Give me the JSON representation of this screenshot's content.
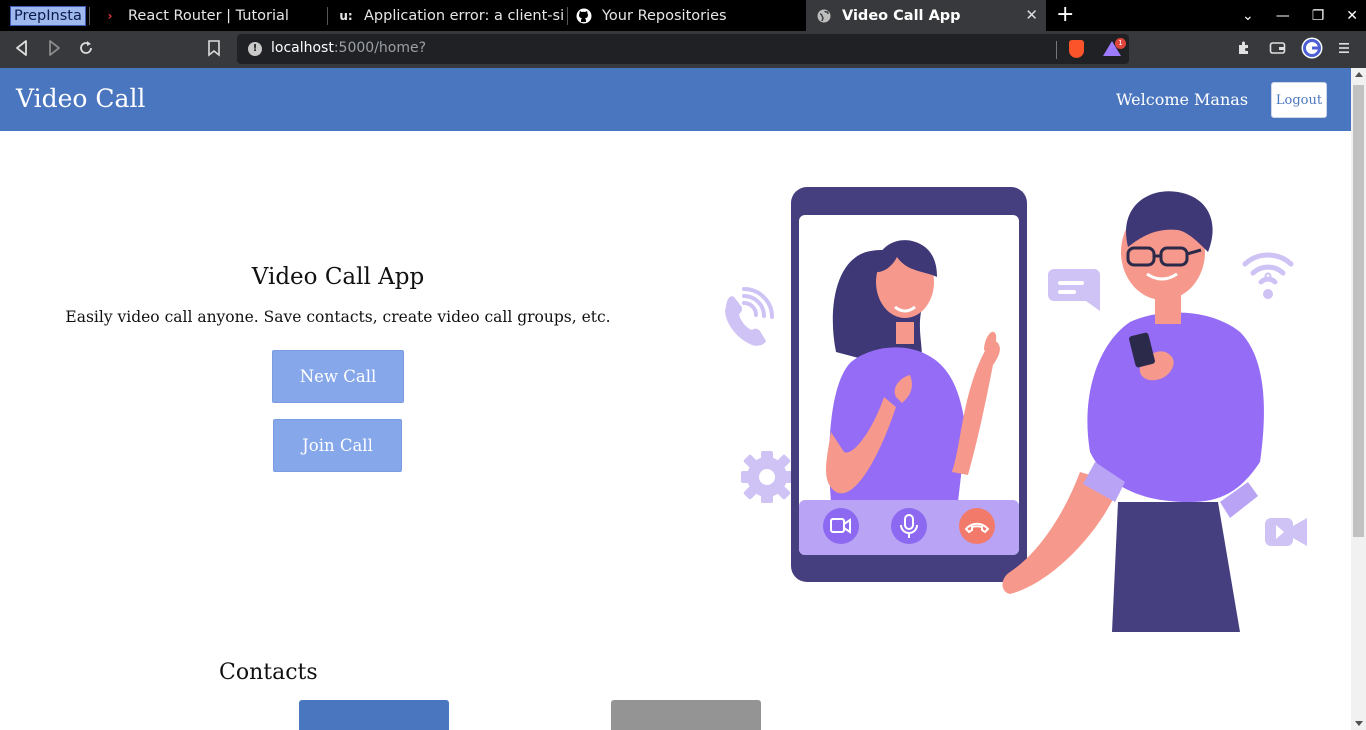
{
  "browser": {
    "tabs": [
      {
        "title": "PrepInsta",
        "favicon": "none"
      },
      {
        "title": "React Router | Tutorial",
        "favicon": "react-router-icon"
      },
      {
        "title": "Application error: a client-side",
        "favicon": "u-icon"
      },
      {
        "title": "Your Repositories",
        "favicon": "github-icon"
      },
      {
        "title": "Video Call App",
        "favicon": "globe-icon",
        "active": true
      }
    ],
    "url_host": "localhost",
    "url_path": ":5000/home?",
    "rewards_badge": "1"
  },
  "app": {
    "brand": "Video Call",
    "welcome": "Welcome Manas",
    "logout_label": "Logout",
    "accent_color": "#4a76bf",
    "button_color": "#86a7ea"
  },
  "hero": {
    "title": "Video Call App",
    "description": "Easily video call anyone. Save contacts, create video call groups, etc.",
    "new_call_label": "New Call",
    "join_call_label": "Join Call"
  },
  "contacts": {
    "title": "Contacts"
  }
}
